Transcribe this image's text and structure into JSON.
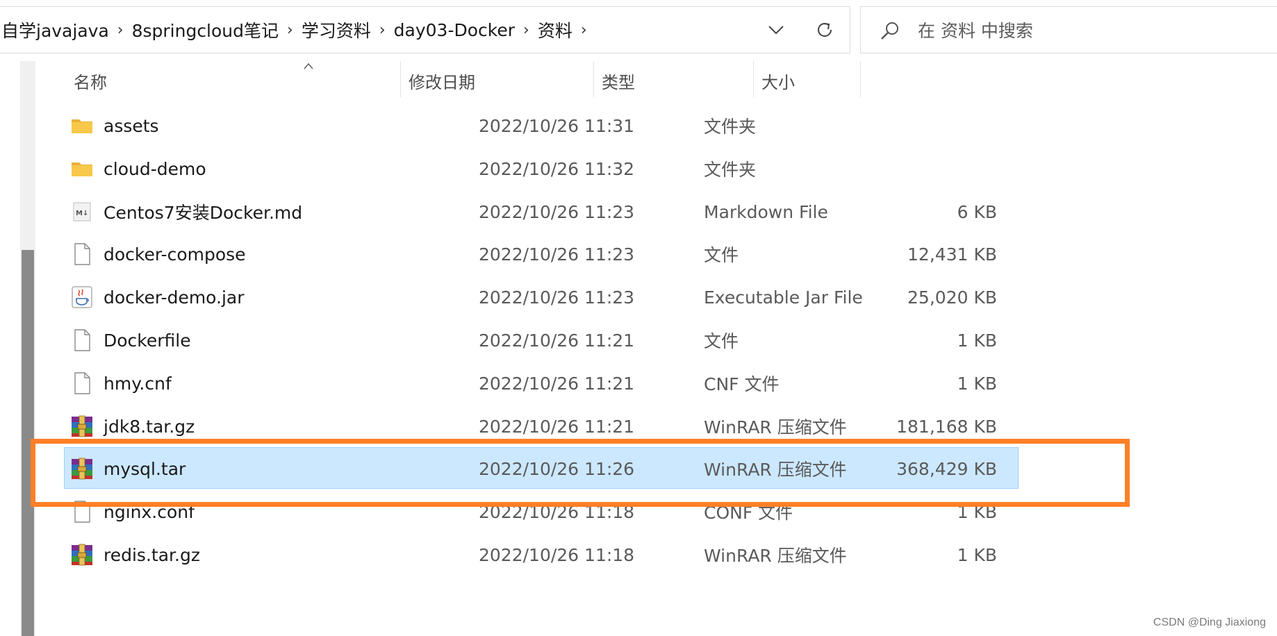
{
  "breadcrumb": [
    "自学javajava",
    "8springcloud笔记",
    "学习资料",
    "day03-Docker",
    "资料"
  ],
  "search": {
    "placeholder": "在 资料 中搜索"
  },
  "columns": {
    "name": "名称",
    "date": "修改日期",
    "type": "类型",
    "size": "大小"
  },
  "files": [
    {
      "name": "assets",
      "date": "2022/10/26 11:31",
      "type": "文件夹",
      "size": "",
      "icon": "folder-icon",
      "selected": false
    },
    {
      "name": "cloud-demo",
      "date": "2022/10/26 11:32",
      "type": "文件夹",
      "size": "",
      "icon": "folder-icon",
      "selected": false
    },
    {
      "name": "Centos7安装Docker.md",
      "date": "2022/10/26 11:23",
      "type": "Markdown File",
      "size": "6 KB",
      "icon": "markdown-file-icon",
      "selected": false
    },
    {
      "name": "docker-compose",
      "date": "2022/10/26 11:23",
      "type": "文件",
      "size": "12,431 KB",
      "icon": "blank-file-icon",
      "selected": false
    },
    {
      "name": "docker-demo.jar",
      "date": "2022/10/26 11:23",
      "type": "Executable Jar File",
      "size": "25,020 KB",
      "icon": "java-jar-icon",
      "selected": false
    },
    {
      "name": "Dockerfile",
      "date": "2022/10/26 11:21",
      "type": "文件",
      "size": "1 KB",
      "icon": "blank-file-icon",
      "selected": false
    },
    {
      "name": "hmy.cnf",
      "date": "2022/10/26 11:21",
      "type": "CNF 文件",
      "size": "1 KB",
      "icon": "blank-file-icon",
      "selected": false
    },
    {
      "name": "jdk8.tar.gz",
      "date": "2022/10/26 11:21",
      "type": "WinRAR 压缩文件",
      "size": "181,168 KB",
      "icon": "winrar-archive-icon",
      "selected": false
    },
    {
      "name": "mysql.tar",
      "date": "2022/10/26 11:26",
      "type": "WinRAR 压缩文件",
      "size": "368,429 KB",
      "icon": "winrar-archive-icon",
      "selected": true
    },
    {
      "name": "nginx.conf",
      "date": "2022/10/26 11:18",
      "type": "CONF 文件",
      "size": "1 KB",
      "icon": "blank-file-icon",
      "selected": false
    },
    {
      "name": "redis.tar.gz",
      "date": "2022/10/26 11:18",
      "type": "WinRAR 压缩文件",
      "size": "1 KB",
      "icon": "winrar-archive-icon",
      "selected": false
    }
  ],
  "colors": {
    "selection": "#cce8ff",
    "selection_border": "#99d1ff",
    "annotation": "#ff7f27",
    "folder": "#f8c84a"
  },
  "watermark": "CSDN @Ding Jiaxiong"
}
